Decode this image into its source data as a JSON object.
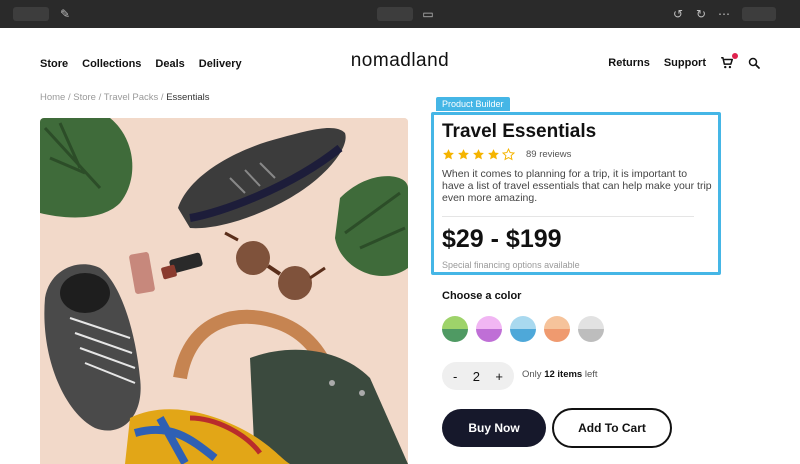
{
  "nav": {
    "links": [
      "Store",
      "Collections",
      "Deals",
      "Delivery"
    ],
    "brand": "nomadland",
    "right_links": [
      "Returns",
      "Support"
    ]
  },
  "breadcrumb": {
    "trail": "Home / Store / Travel Packs / ",
    "current": "Essentials"
  },
  "product": {
    "builder_tag": "Product Builder",
    "title": "Travel Essentials",
    "rating": 4,
    "rating_max": 5,
    "reviews": "89 reviews",
    "description": "When it comes to planning for a trip, it is important to have a list of travel essentials that can help make your trip even more amazing.",
    "price": "$29 - $199",
    "financing": "Special financing options available"
  },
  "color": {
    "label": "Choose a color",
    "swatches": [
      {
        "top": "#9ed36a",
        "bottom": "#4f9a63"
      },
      {
        "top": "#f1b6f3",
        "bottom": "#bf6fd6"
      },
      {
        "top": "#a9d9ef",
        "bottom": "#4ea8d9"
      },
      {
        "top": "#f6c39b",
        "bottom": "#ef9a6f"
      },
      {
        "top": "#e2e2e2",
        "bottom": "#bdbdbd"
      }
    ]
  },
  "quantity": {
    "minus": "-",
    "value": "2",
    "plus": "+",
    "stock_prefix": "Only ",
    "stock_count": "12 items",
    "stock_suffix": " left"
  },
  "actions": {
    "buy": "Buy Now",
    "cart": "Add To Cart"
  },
  "colors": {
    "accent": "#45b6e6",
    "star": "#f5b400",
    "dark_button": "#16182b",
    "cart_dot": "#e0224e"
  }
}
